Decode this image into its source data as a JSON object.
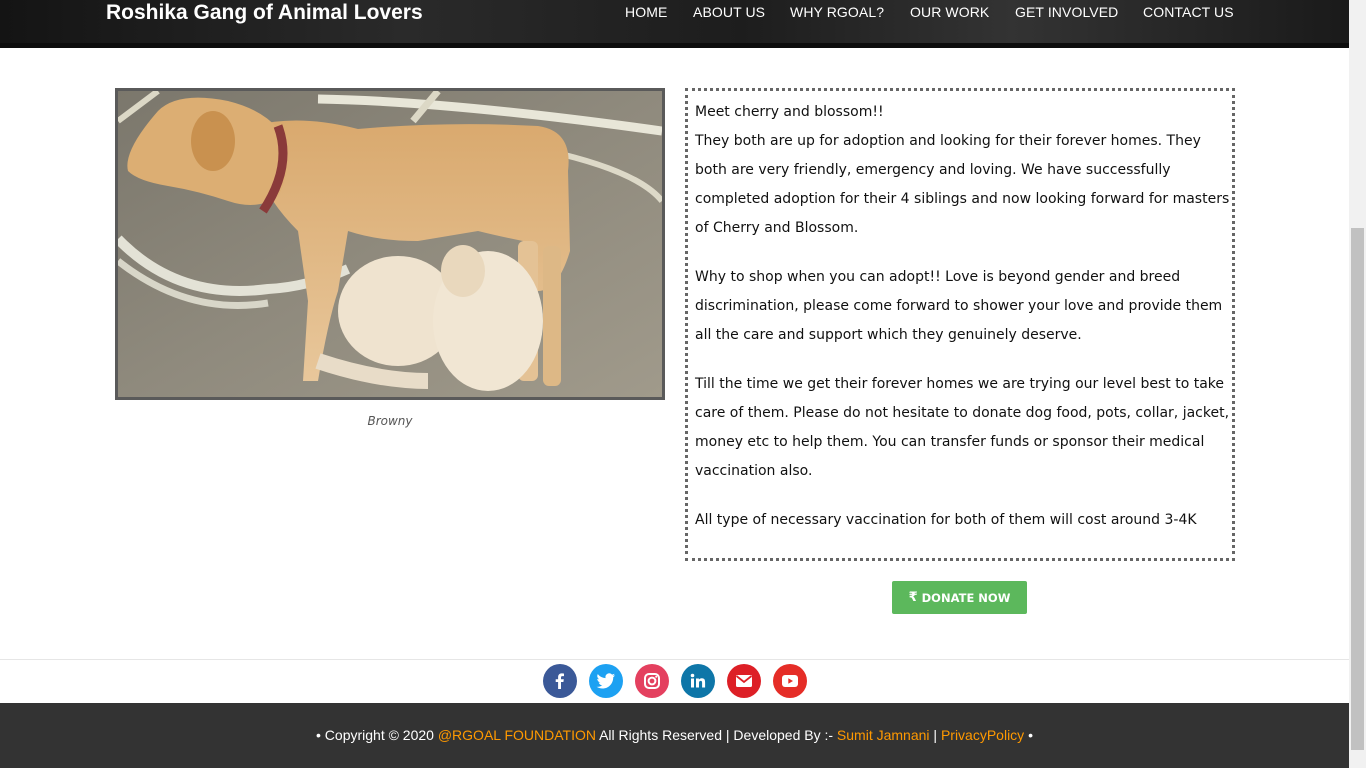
{
  "nav": {
    "brand": "Roshika Gang of Animal Lovers",
    "items": [
      "HOME",
      "ABOUT US",
      "WHY RGOAL?",
      "OUR WORK",
      "GET INVOLVED",
      "CONTACT US"
    ]
  },
  "photo": {
    "caption": "Browny"
  },
  "story": {
    "p1_line1": "Meet cherry and blossom!!",
    "p1_line2": "They both are up for adoption and looking for their forever homes. They both are very friendly, emergency and loving. We have successfully completed adoption for their 4 siblings and now looking forward for masters of Cherry and Blossom.",
    "p2": "Why to shop when you can adopt!! Love is beyond gender and breed discrimination, please come forward to shower your love and provide them all the care and support which they genuinely deserve.",
    "p3": "Till the time we get their forever homes we are trying our level best to take care of them. Please do not hesitate to donate dog food, pots, collar, jacket, money etc to help them. You can transfer funds or sponsor their medical vaccination also.",
    "p4": "All type of necessary vaccination for both of them will cost around 3-4K"
  },
  "donate": {
    "label": "DONATE NOW",
    "icon": "₹"
  },
  "social": [
    {
      "name": "facebook-icon",
      "color": "#3b5998"
    },
    {
      "name": "twitter-icon",
      "color": "#1da1f2"
    },
    {
      "name": "instagram-icon",
      "color": "#e4405f"
    },
    {
      "name": "linkedin-icon",
      "color": "#0e76a8"
    },
    {
      "name": "email-icon",
      "color": "#dd1f26"
    },
    {
      "name": "youtube-icon",
      "color": "#e52d27"
    }
  ],
  "footer": {
    "prefix": "• Copyright © 2020 ",
    "org": "@RGOAL FOUNDATION",
    "middle": " All Rights Reserved | Developed By :- ",
    "developer": "Sumit Jamnani",
    "sep": " | ",
    "privacy": "PrivacyPolicy",
    "suffix": " •"
  },
  "colors": {
    "accent_orange": "#ff9900",
    "donate_green": "#5cb85c",
    "footer_bg": "#333333"
  }
}
